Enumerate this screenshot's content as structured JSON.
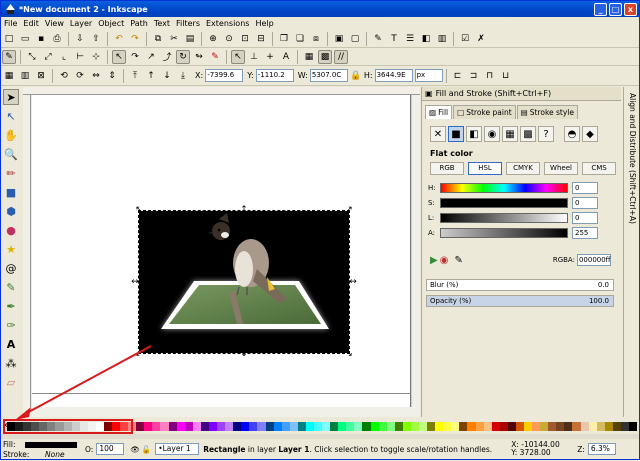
{
  "window": {
    "title": "*New document 2 - Inkscape",
    "min": "_",
    "max": "□",
    "close": "x"
  },
  "menu": [
    "File",
    "Edit",
    "View",
    "Layer",
    "Object",
    "Path",
    "Text",
    "Filters",
    "Extensions",
    "Help"
  ],
  "toolbar3": {
    "x_label": "X:",
    "x_value": "-7399.6",
    "y_label": "Y:",
    "y_value": "-1110.2",
    "w_label": "W:",
    "w_value": "5307.0C",
    "h_label": "H:",
    "h_value": "3644.9E",
    "unit": "px"
  },
  "dock": {
    "title": "Fill and Stroke (Shift+Ctrl+F)",
    "tabs": [
      "Fill",
      "Stroke paint",
      "Stroke style"
    ],
    "flat_label": "Flat color",
    "modes": [
      "RGB",
      "HSL",
      "CMYK",
      "Wheel",
      "CMS"
    ],
    "sliders": [
      {
        "label": "H:",
        "value": "0"
      },
      {
        "label": "S:",
        "value": "0"
      },
      {
        "label": "L:",
        "value": "0"
      },
      {
        "label": "A:",
        "value": "255"
      }
    ],
    "rgba_label": "RGBA:",
    "rgba_value": "000000ff",
    "blur_label": "Blur (%)",
    "blur_value": "0.0",
    "opacity_label": "Opacity (%)",
    "opacity_value": "100.0",
    "side_tab": "Align and Distribute (Shift+Ctrl+A)"
  },
  "status": {
    "fill_label": "Fill:",
    "stroke_label": "Stroke:",
    "stroke_value": "None",
    "o_label": "O:",
    "o_value": "100",
    "layer": "•Layer 1",
    "msg_obj": "Rectangle",
    "msg_rest": " in layer ",
    "msg_layer": "Layer 1",
    "msg_tail": ". Click selection to toggle scale/rotation handles.",
    "x": "X: -10144.00",
    "y": "Y:   3728.00",
    "zoom_label": "Z:",
    "zoom_value": "6.3%"
  },
  "palette_colors": [
    "#000000",
    "#1a1a1a",
    "#333333",
    "#4d4d4d",
    "#666666",
    "#808080",
    "#999999",
    "#b3b3b3",
    "#cccccc",
    "#e6e6e6",
    "#f2f2f2",
    "#ffffff",
    "#800000",
    "#ff0000",
    "#ff4040",
    "#ff8080",
    "#800040",
    "#ff0080",
    "#ff40a0",
    "#ff80c0",
    "#800080",
    "#ff00ff",
    "#c000c0",
    "#ff80ff",
    "#400080",
    "#8000ff",
    "#a040ff",
    "#c080ff",
    "#000080",
    "#0000ff",
    "#4040ff",
    "#8080ff",
    "#004080",
    "#0080ff",
    "#40a0ff",
    "#80c0ff",
    "#008080",
    "#00ffff",
    "#40ffff",
    "#80ffff",
    "#008040",
    "#00ff80",
    "#40ffa0",
    "#80ffc0",
    "#008000",
    "#00ff00",
    "#40ff40",
    "#80ff80",
    "#408000",
    "#80ff00",
    "#a0ff40",
    "#c0ff80",
    "#808000",
    "#ffff00",
    "#ffff40",
    "#ffff80",
    "#804000",
    "#ff8000",
    "#ffa040",
    "#ffc080",
    "#d40000",
    "#aa0000",
    "#550000",
    "#d45500",
    "#ffcc00",
    "#ff9955",
    "#c8ab37",
    "#a05a2c",
    "#784421",
    "#502d16",
    "#c87137",
    "#e9c6af",
    "#ffeeaa",
    "#d3bc5f",
    "#aa8800",
    "#554400",
    "#333333",
    "#000000"
  ],
  "colors": {
    "accent": "#0a5fdd",
    "highlight": "#d9191c"
  }
}
